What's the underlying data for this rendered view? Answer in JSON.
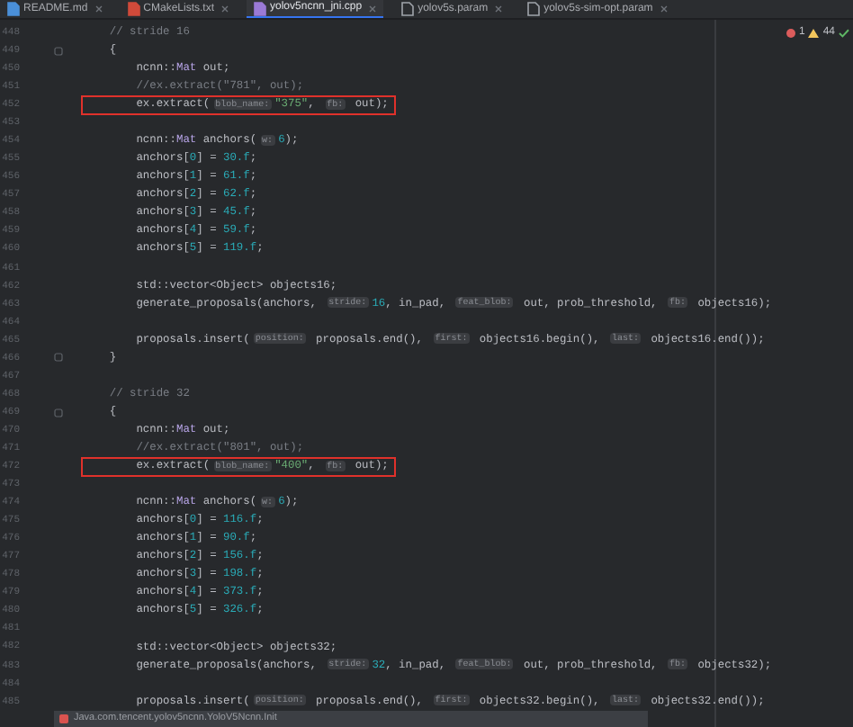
{
  "tabs": [
    {
      "label": "README.md",
      "selected": false
    },
    {
      "label": "CMakeLists.txt",
      "selected": false
    },
    {
      "label": "yolov5ncnn_jni.cpp",
      "selected": true
    },
    {
      "label": "yolov5s.param",
      "selected": false
    },
    {
      "label": "yolov5s-sim-opt.param",
      "selected": false
    }
  ],
  "inspections": {
    "errors": "1",
    "warnings": "44"
  },
  "lines": [
    {
      "number": "448",
      "fold": false,
      "highlighted": false,
      "tokens": [
        {
          "kind": "comment",
          "text": "    // stride 16"
        }
      ]
    },
    {
      "number": "449",
      "fold": true,
      "highlighted": false,
      "tokens": [
        {
          "kind": "code",
          "text": "    {"
        }
      ]
    },
    {
      "number": "450",
      "fold": false,
      "highlighted": false,
      "tokens": [
        {
          "kind": "code",
          "text": "        ncnn::"
        },
        {
          "kind": "type",
          "text": "Mat"
        },
        {
          "kind": "code",
          "text": " out;"
        }
      ]
    },
    {
      "number": "451",
      "fold": false,
      "highlighted": false,
      "tokens": [
        {
          "kind": "comment",
          "text": "        //ex.extract(\"781\", out);"
        }
      ]
    },
    {
      "number": "452",
      "fold": false,
      "highlighted": true,
      "tokens": [
        {
          "kind": "code",
          "text": "        ex.extract("
        },
        {
          "kind": "hint",
          "text": "blob_name:"
        },
        {
          "kind": "str",
          "text": "\"375\""
        },
        {
          "kind": "code",
          "text": ", "
        },
        {
          "kind": "hint",
          "text": "fb:"
        },
        {
          "kind": "code",
          "text": " out);"
        }
      ]
    },
    {
      "number": "453",
      "fold": false,
      "highlighted": false
    },
    {
      "number": "454",
      "fold": false,
      "highlighted": false,
      "tokens": [
        {
          "kind": "code",
          "text": "        ncnn::"
        },
        {
          "kind": "type",
          "text": "Mat"
        },
        {
          "kind": "code",
          "text": " anchors("
        },
        {
          "kind": "hint",
          "text": "w:"
        },
        {
          "kind": "num",
          "text": "6"
        },
        {
          "kind": "code",
          "text": ");"
        }
      ]
    },
    {
      "number": "455",
      "fold": false,
      "highlighted": false,
      "tokens": [
        {
          "kind": "code",
          "text": "        anchors["
        },
        {
          "kind": "num",
          "text": "0"
        },
        {
          "kind": "code",
          "text": "] = "
        },
        {
          "kind": "num",
          "text": "30.f"
        },
        {
          "kind": "code",
          "text": ";"
        }
      ]
    },
    {
      "number": "456",
      "fold": false,
      "highlighted": false,
      "tokens": [
        {
          "kind": "code",
          "text": "        anchors["
        },
        {
          "kind": "num",
          "text": "1"
        },
        {
          "kind": "code",
          "text": "] = "
        },
        {
          "kind": "num",
          "text": "61.f"
        },
        {
          "kind": "code",
          "text": ";"
        }
      ]
    },
    {
      "number": "457",
      "fold": false,
      "highlighted": false,
      "tokens": [
        {
          "kind": "code",
          "text": "        anchors["
        },
        {
          "kind": "num",
          "text": "2"
        },
        {
          "kind": "code",
          "text": "] = "
        },
        {
          "kind": "num",
          "text": "62.f"
        },
        {
          "kind": "code",
          "text": ";"
        }
      ]
    },
    {
      "number": "458",
      "fold": false,
      "highlighted": false,
      "tokens": [
        {
          "kind": "code",
          "text": "        anchors["
        },
        {
          "kind": "num",
          "text": "3"
        },
        {
          "kind": "code",
          "text": "] = "
        },
        {
          "kind": "num",
          "text": "45.f"
        },
        {
          "kind": "code",
          "text": ";"
        }
      ]
    },
    {
      "number": "459",
      "fold": false,
      "highlighted": false,
      "tokens": [
        {
          "kind": "code",
          "text": "        anchors["
        },
        {
          "kind": "num",
          "text": "4"
        },
        {
          "kind": "code",
          "text": "] = "
        },
        {
          "kind": "num",
          "text": "59.f"
        },
        {
          "kind": "code",
          "text": ";"
        }
      ]
    },
    {
      "number": "460",
      "fold": false,
      "highlighted": false,
      "tokens": [
        {
          "kind": "code",
          "text": "        anchors["
        },
        {
          "kind": "num",
          "text": "5"
        },
        {
          "kind": "code",
          "text": "] = "
        },
        {
          "kind": "num",
          "text": "119.f"
        },
        {
          "kind": "code",
          "text": ";"
        }
      ]
    },
    {
      "number": "461",
      "fold": false,
      "highlighted": false
    },
    {
      "number": "462",
      "fold": false,
      "highlighted": false,
      "tokens": [
        {
          "kind": "code",
          "text": "        std::vector<Object> objects16;"
        }
      ]
    },
    {
      "number": "463",
      "fold": false,
      "highlighted": false,
      "tokens": [
        {
          "kind": "code",
          "text": "        generate_proposals(anchors, "
        },
        {
          "kind": "hint",
          "text": "stride:"
        },
        {
          "kind": "num",
          "text": "16"
        },
        {
          "kind": "code",
          "text": ", in_pad, "
        },
        {
          "kind": "hint",
          "text": "feat_blob:"
        },
        {
          "kind": "code",
          "text": " out, prob_threshold, "
        },
        {
          "kind": "hint",
          "text": "fb:"
        },
        {
          "kind": "code",
          "text": " objects16);"
        }
      ]
    },
    {
      "number": "464",
      "fold": false,
      "highlighted": false
    },
    {
      "number": "465",
      "fold": false,
      "highlighted": false,
      "tokens": [
        {
          "kind": "code",
          "text": "        proposals.insert("
        },
        {
          "kind": "hint",
          "text": "position:"
        },
        {
          "kind": "code",
          "text": " proposals.end(), "
        },
        {
          "kind": "hint",
          "text": "first:"
        },
        {
          "kind": "code",
          "text": " objects16.begin(), "
        },
        {
          "kind": "hint",
          "text": "last:"
        },
        {
          "kind": "code",
          "text": " objects16.end());"
        }
      ]
    },
    {
      "number": "466",
      "fold": true,
      "highlighted": false,
      "tokens": [
        {
          "kind": "code",
          "text": "    }"
        }
      ]
    },
    {
      "number": "467",
      "fold": false,
      "highlighted": false
    },
    {
      "number": "468",
      "fold": false,
      "highlighted": false,
      "tokens": [
        {
          "kind": "comment",
          "text": "    // stride 32"
        }
      ]
    },
    {
      "number": "469",
      "fold": true,
      "highlighted": false,
      "tokens": [
        {
          "kind": "code",
          "text": "    {"
        }
      ]
    },
    {
      "number": "470",
      "fold": false,
      "highlighted": false,
      "tokens": [
        {
          "kind": "code",
          "text": "        ncnn::"
        },
        {
          "kind": "type",
          "text": "Mat"
        },
        {
          "kind": "code",
          "text": " out;"
        }
      ]
    },
    {
      "number": "471",
      "fold": false,
      "highlighted": false,
      "tokens": [
        {
          "kind": "comment",
          "text": "        //ex.extract(\"801\", out);"
        }
      ]
    },
    {
      "number": "472",
      "fold": false,
      "highlighted": true,
      "tokens": [
        {
          "kind": "code",
          "text": "        ex.extract("
        },
        {
          "kind": "hint",
          "text": "blob_name:"
        },
        {
          "kind": "str",
          "text": "\"400\""
        },
        {
          "kind": "code",
          "text": ", "
        },
        {
          "kind": "hint",
          "text": "fb:"
        },
        {
          "kind": "code",
          "text": " out);"
        }
      ]
    },
    {
      "number": "473",
      "fold": false,
      "highlighted": false
    },
    {
      "number": "474",
      "fold": false,
      "highlighted": false,
      "tokens": [
        {
          "kind": "code",
          "text": "        ncnn::"
        },
        {
          "kind": "type",
          "text": "Mat"
        },
        {
          "kind": "code",
          "text": " anchors("
        },
        {
          "kind": "hint",
          "text": "w:"
        },
        {
          "kind": "num",
          "text": "6"
        },
        {
          "kind": "code",
          "text": ");"
        }
      ]
    },
    {
      "number": "475",
      "fold": false,
      "highlighted": false,
      "tokens": [
        {
          "kind": "code",
          "text": "        anchors["
        },
        {
          "kind": "num",
          "text": "0"
        },
        {
          "kind": "code",
          "text": "] = "
        },
        {
          "kind": "num",
          "text": "116.f"
        },
        {
          "kind": "code",
          "text": ";"
        }
      ]
    },
    {
      "number": "476",
      "fold": false,
      "highlighted": false,
      "tokens": [
        {
          "kind": "code",
          "text": "        anchors["
        },
        {
          "kind": "num",
          "text": "1"
        },
        {
          "kind": "code",
          "text": "] = "
        },
        {
          "kind": "num",
          "text": "90.f"
        },
        {
          "kind": "code",
          "text": ";"
        }
      ]
    },
    {
      "number": "477",
      "fold": false,
      "highlighted": false,
      "tokens": [
        {
          "kind": "code",
          "text": "        anchors["
        },
        {
          "kind": "num",
          "text": "2"
        },
        {
          "kind": "code",
          "text": "] = "
        },
        {
          "kind": "num",
          "text": "156.f"
        },
        {
          "kind": "code",
          "text": ";"
        }
      ]
    },
    {
      "number": "478",
      "fold": false,
      "highlighted": false,
      "tokens": [
        {
          "kind": "code",
          "text": "        anchors["
        },
        {
          "kind": "num",
          "text": "3"
        },
        {
          "kind": "code",
          "text": "] = "
        },
        {
          "kind": "num",
          "text": "198.f"
        },
        {
          "kind": "code",
          "text": ";"
        }
      ]
    },
    {
      "number": "479",
      "fold": false,
      "highlighted": false,
      "tokens": [
        {
          "kind": "code",
          "text": "        anchors["
        },
        {
          "kind": "num",
          "text": "4"
        },
        {
          "kind": "code",
          "text": "] = "
        },
        {
          "kind": "num",
          "text": "373.f"
        },
        {
          "kind": "code",
          "text": ";"
        }
      ]
    },
    {
      "number": "480",
      "fold": false,
      "highlighted": false,
      "tokens": [
        {
          "kind": "code",
          "text": "        anchors["
        },
        {
          "kind": "num",
          "text": "5"
        },
        {
          "kind": "code",
          "text": "] = "
        },
        {
          "kind": "num",
          "text": "326.f"
        },
        {
          "kind": "code",
          "text": ";"
        }
      ]
    },
    {
      "number": "481",
      "fold": false,
      "highlighted": false
    },
    {
      "number": "482",
      "fold": false,
      "highlighted": false,
      "tokens": [
        {
          "kind": "code",
          "text": "        std::vector<Object> objects32;"
        }
      ]
    },
    {
      "number": "483",
      "fold": false,
      "highlighted": false,
      "tokens": [
        {
          "kind": "code",
          "text": "        generate_proposals(anchors, "
        },
        {
          "kind": "hint",
          "text": "stride:"
        },
        {
          "kind": "num",
          "text": "32"
        },
        {
          "kind": "code",
          "text": ", in_pad, "
        },
        {
          "kind": "hint",
          "text": "feat_blob:"
        },
        {
          "kind": "code",
          "text": " out, prob_threshold, "
        },
        {
          "kind": "hint",
          "text": "fb:"
        },
        {
          "kind": "code",
          "text": " objects32);"
        }
      ]
    },
    {
      "number": "484",
      "fold": false,
      "highlighted": false
    },
    {
      "number": "485",
      "fold": false,
      "highlighted": false,
      "tokens": [
        {
          "kind": "code",
          "text": "        proposals.insert("
        },
        {
          "kind": "hint",
          "text": "position:"
        },
        {
          "kind": "code",
          "text": " proposals.end(), "
        },
        {
          "kind": "hint",
          "text": "first:"
        },
        {
          "kind": "code",
          "text": " objects32.begin(), "
        },
        {
          "kind": "hint",
          "text": "last:"
        },
        {
          "kind": "code",
          "text": " objects32.end());"
        }
      ]
    }
  ],
  "breadcrumb": "Java.com.tencent.yolov5ncnn.YoloV5Ncnn.Init"
}
